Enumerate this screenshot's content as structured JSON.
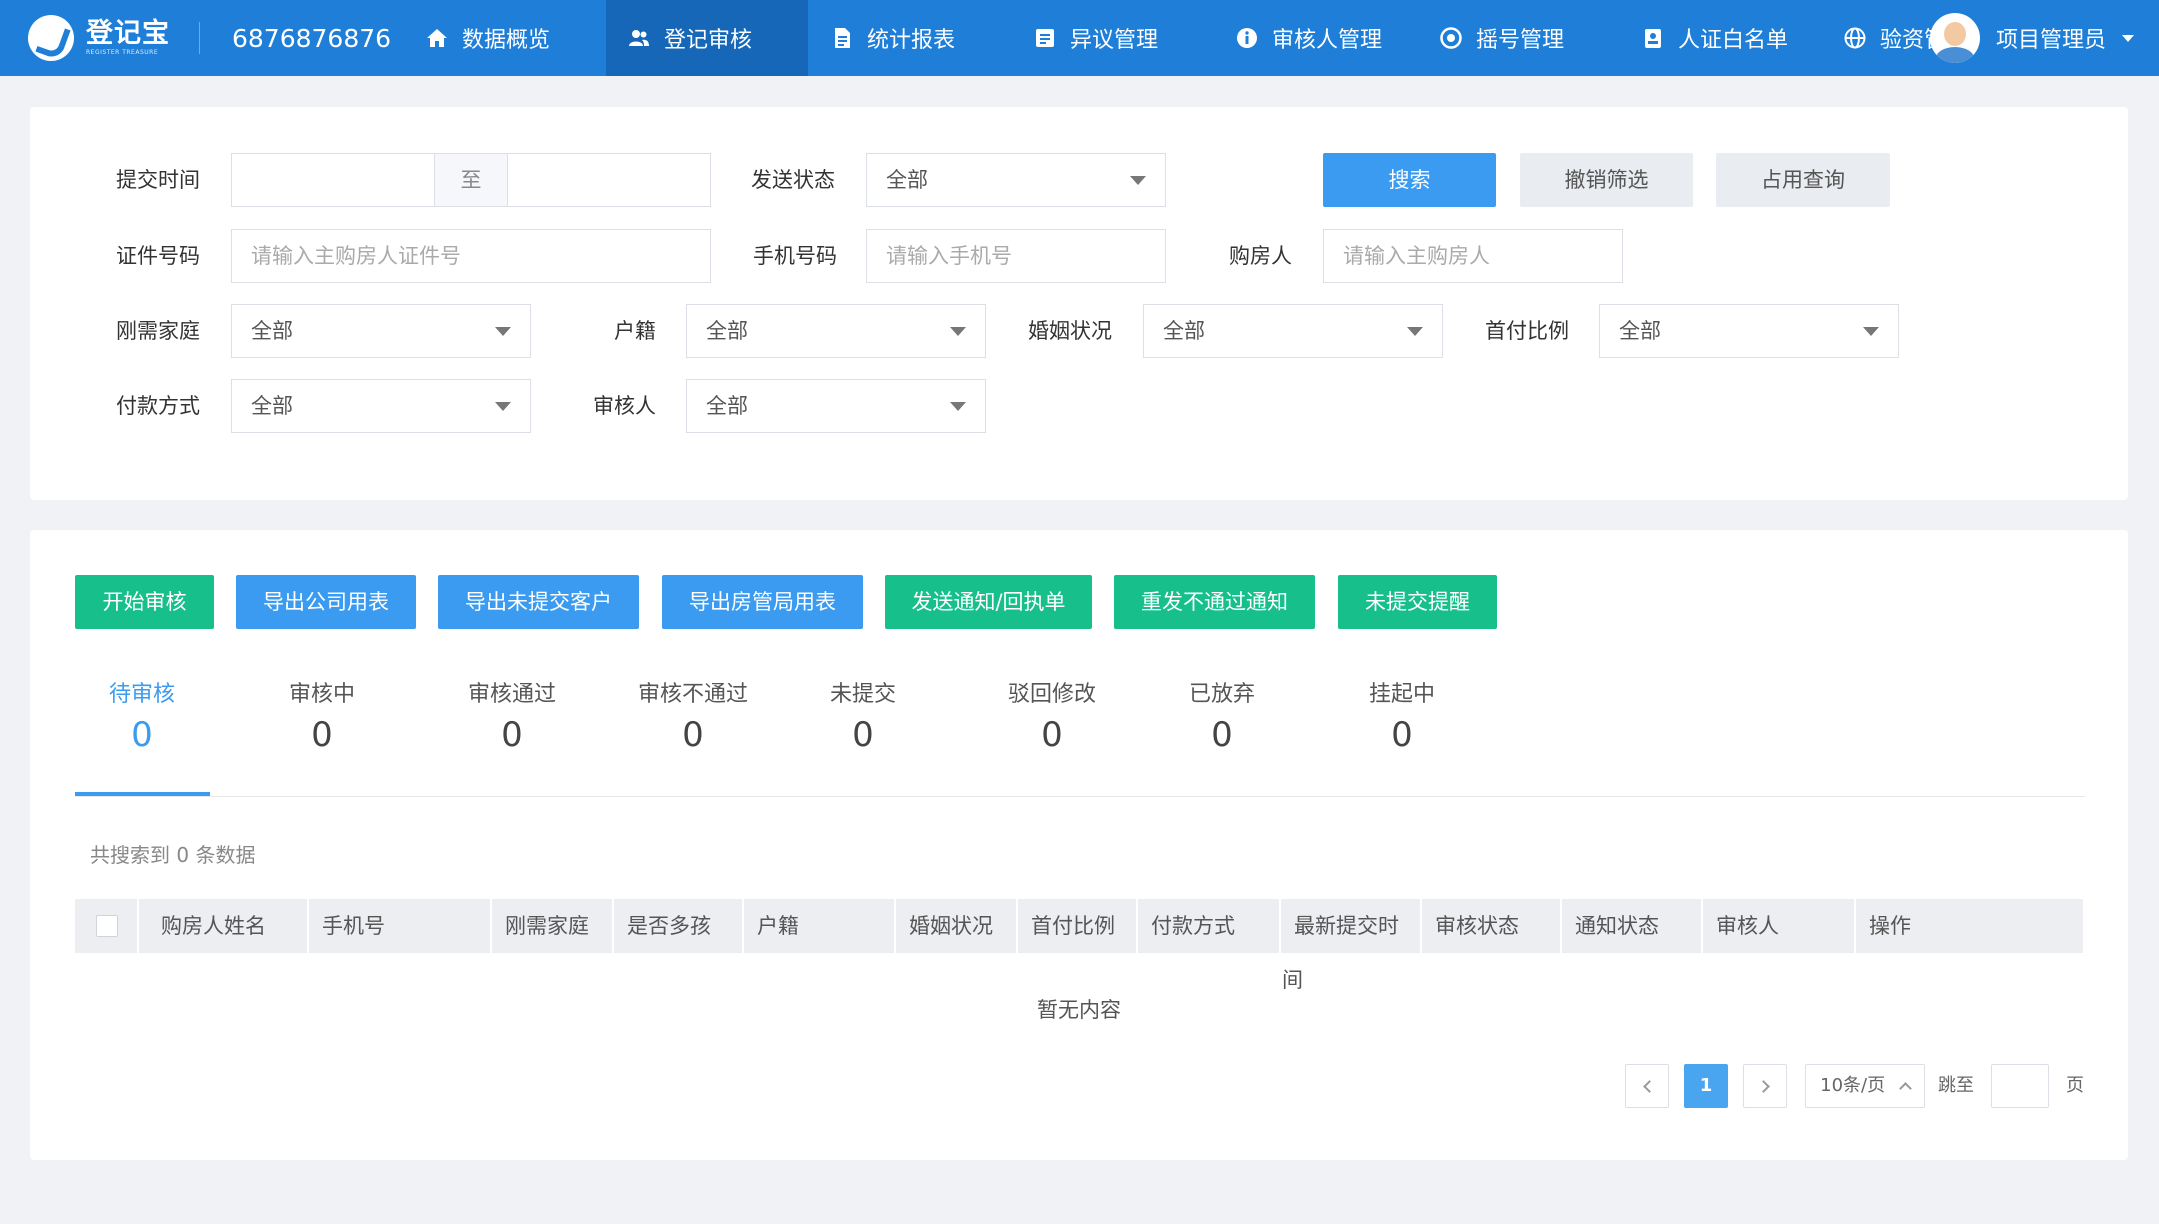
{
  "header": {
    "logo_text": "登记宝",
    "logo_sub": "REGISTER TREASURE",
    "phone": "6876876876",
    "nav": [
      {
        "label": "数据概览",
        "icon": "home-icon"
      },
      {
        "label": "登记审核",
        "icon": "users-icon",
        "active": true
      },
      {
        "label": "统计报表",
        "icon": "document-icon"
      },
      {
        "label": "异议管理",
        "icon": "edit-box-icon"
      },
      {
        "label": "审核人管理",
        "icon": "info-circle-icon"
      },
      {
        "label": "摇号管理",
        "icon": "target-icon"
      },
      {
        "label": "人证白名单",
        "icon": "id-badge-icon"
      },
      {
        "label": "验资管",
        "icon": "globe-icon"
      }
    ],
    "user_name": "项目管理员"
  },
  "filters": {
    "submit_time_label": "提交时间",
    "date_separator": "至",
    "send_status_label": "发送状态",
    "send_status_value": "全部",
    "search_button": "搜索",
    "reset_button": "撤销筛选",
    "occupy_button": "占用查询",
    "id_label": "证件号码",
    "id_placeholder": "请输入主购房人证件号",
    "mobile_label": "手机号码",
    "mobile_placeholder": "请输入手机号",
    "buyer_label": "购房人",
    "buyer_placeholder": "请输入主购房人",
    "rigid_label": "刚需家庭",
    "rigid_value": "全部",
    "hukou_label": "户籍",
    "hukou_value": "全部",
    "marital_label": "婚姻状况",
    "marital_value": "全部",
    "downpay_label": "首付比例",
    "downpay_value": "全部",
    "paymethod_label": "付款方式",
    "paymethod_value": "全部",
    "reviewer_label": "审核人",
    "reviewer_value": "全部"
  },
  "actions": {
    "start_review": "开始审核",
    "export_company": "导出公司用表",
    "export_unsubmitted": "导出未提交客户",
    "export_housing": "导出房管局用表",
    "send_notice": "发送通知/回执单",
    "resend_fail": "重发不通过通知",
    "remind_unsubmitted": "未提交提醒"
  },
  "tabs": [
    {
      "label": "待审核",
      "count": "0"
    },
    {
      "label": "审核中",
      "count": "0"
    },
    {
      "label": "审核通过",
      "count": "0"
    },
    {
      "label": "审核不通过",
      "count": "0"
    },
    {
      "label": "未提交",
      "count": "0"
    },
    {
      "label": "驳回修改",
      "count": "0"
    },
    {
      "label": "已放弃",
      "count": "0"
    },
    {
      "label": "挂起中",
      "count": "0"
    }
  ],
  "table": {
    "result_text": "共搜索到 0 条数据",
    "columns": [
      "购房人姓名",
      "手机号",
      "刚需家庭",
      "是否多孩",
      "户籍",
      "婚姻状况",
      "首付比例",
      "付款方式",
      "最新提交时",
      "审核状态",
      "通知状态",
      "审核人",
      "操作"
    ],
    "column_wrap": "间",
    "empty_text": "暂无内容"
  },
  "pagination": {
    "current_page": "1",
    "page_size": "10条/页",
    "jump_label": "跳至",
    "page_suffix": "页"
  }
}
